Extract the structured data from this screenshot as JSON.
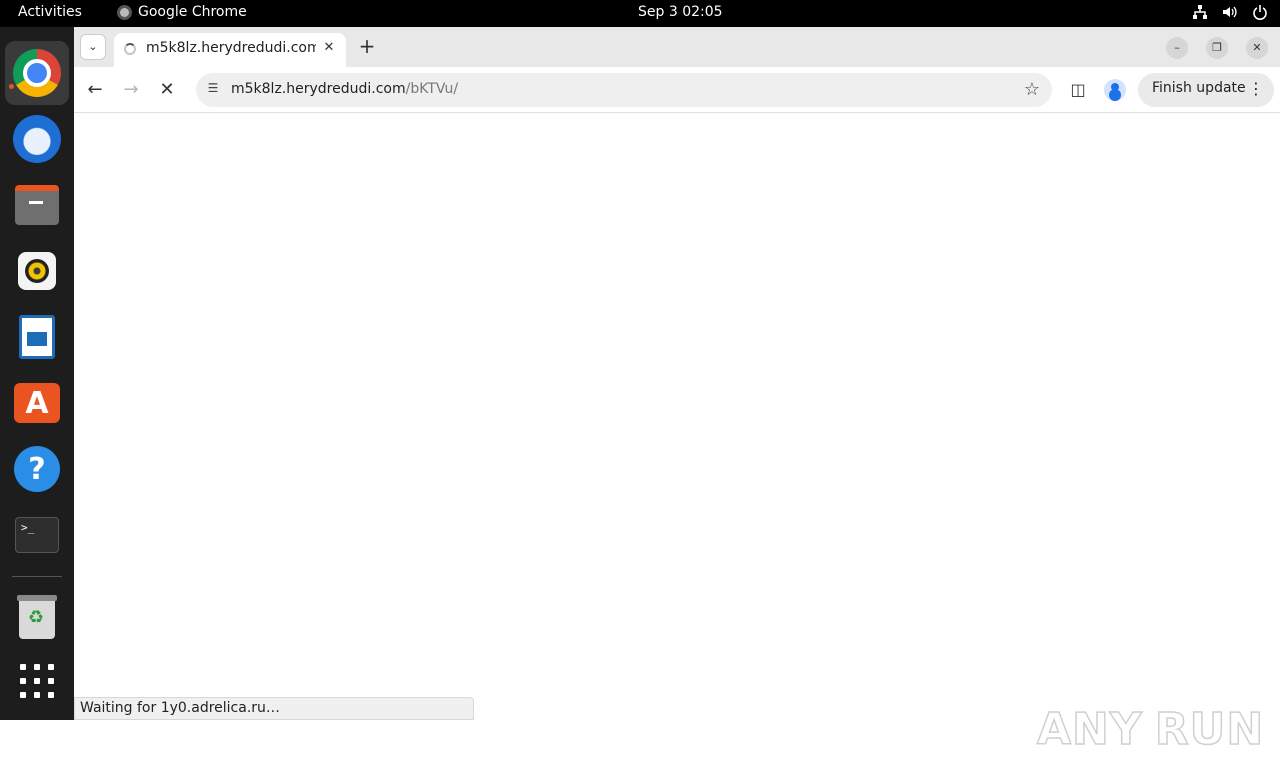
{
  "topbar": {
    "activities": "Activities",
    "app_name": "Google Chrome",
    "clock": "Sep 3  02:05",
    "tray_icons": [
      "network-icon",
      "volume-icon",
      "power-icon"
    ]
  },
  "dock": {
    "items": [
      {
        "name": "google-chrome",
        "icon": "chrome-icon",
        "active": true
      },
      {
        "name": "thunderbird",
        "icon": "thunderbird-icon"
      },
      {
        "name": "files",
        "icon": "files-icon"
      },
      {
        "name": "rhythmbox",
        "icon": "rhythmbox-icon"
      },
      {
        "name": "libreoffice-writer",
        "icon": "writer-icon"
      },
      {
        "name": "ubuntu-software",
        "icon": "app-store-icon"
      },
      {
        "name": "help",
        "icon": "help-icon"
      },
      {
        "name": "terminal",
        "icon": "terminal-icon"
      },
      {
        "name": "trash",
        "icon": "trash-icon"
      },
      {
        "name": "show-applications",
        "icon": "app-grid-icon"
      }
    ],
    "terminal_glyph": ">_",
    "help_glyph": "?",
    "appstore_glyph": "A"
  },
  "browser": {
    "tab": {
      "title": "m5k8lz.herydredudi.com",
      "loading": true
    },
    "omnibox": {
      "host": "m5k8lz.herydredudi.com",
      "path": "/bKTVu/"
    },
    "finish_update_label": "Finish update",
    "status_text": "Waiting for 1y0.adrelica.ru…"
  },
  "watermark": {
    "left": "ANY",
    "right": "RUN"
  },
  "colors": {
    "topbar_bg": "#000000",
    "dock_bg": "#1d1d1d",
    "ubuntu_orange": "#e95420",
    "tabstrip_bg": "#e8e8e8",
    "omnibox_bg": "#efefef"
  }
}
